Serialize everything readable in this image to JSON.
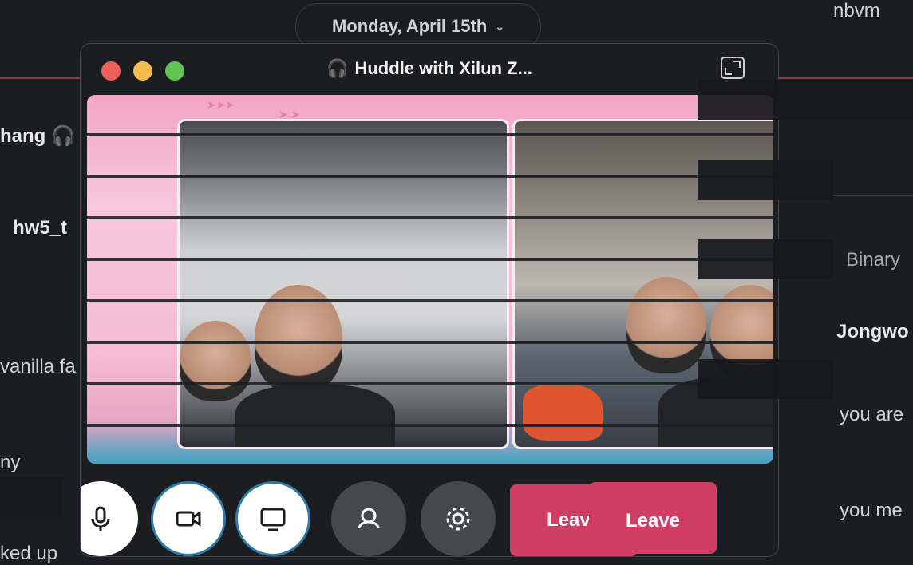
{
  "background": {
    "date_pill": {
      "label": "Monday, April 15th"
    },
    "right_panel": {
      "top_text": "nbvm",
      "binary_text": "Binary",
      "sender": "Jongwo",
      "line1": "you are",
      "line2": "you me"
    },
    "left_panel": {
      "user_fragment": "hang",
      "file_fragment": "hw5_t",
      "msg1": "vanilla fa",
      "msg2": "ny",
      "msg3": "ked up"
    }
  },
  "huddle": {
    "title": "Huddle with Xilun Z...",
    "title_icon": "headphones-icon",
    "expand_icon": "expand-icon",
    "controls": [
      {
        "name": "mic-button",
        "icon": "microphone-icon"
      },
      {
        "name": "camera-button",
        "icon": "video-camera-icon"
      },
      {
        "name": "screen-share-button",
        "icon": "screen-share-icon"
      },
      {
        "name": "effects-button",
        "icon": "background-effects-icon"
      },
      {
        "name": "settings-button",
        "icon": "gear-icon"
      }
    ],
    "leave_label": "Leave"
  },
  "colors": {
    "app_bg": "#1a1d21",
    "leave": "#d13e63",
    "stage_pink": "#f5bcd4",
    "traffic_red": "#ee5f57",
    "traffic_yellow": "#f5bd4f",
    "traffic_green": "#60c454"
  }
}
